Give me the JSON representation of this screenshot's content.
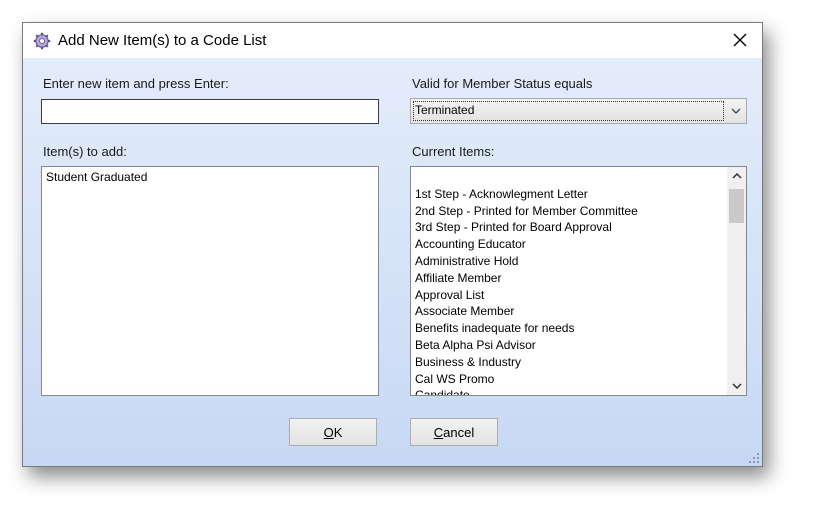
{
  "dialog": {
    "title": "Add New Item(s) to a Code List",
    "close_glyph": "✕"
  },
  "new_item": {
    "label": "Enter new item and press Enter:",
    "value": ""
  },
  "member_status": {
    "label": "Valid for Member Status equals",
    "selected": "Terminated"
  },
  "items_to_add": {
    "label": "Item(s) to add:",
    "items": [
      "Student Graduated"
    ]
  },
  "current_items": {
    "label": "Current Items:",
    "items": [
      "",
      "1st Step - Acknowlegment Letter",
      "2nd Step - Printed for Member Committee",
      "3rd Step - Printed for Board Approval",
      "Accounting Educator",
      "Administrative Hold",
      "Affiliate Member",
      "Approval List",
      "Associate Member",
      "Benefits inadequate for needs",
      "Beta Alpha Psi Advisor",
      "Business & Industry",
      "Cal WS Promo",
      "Candidate"
    ]
  },
  "buttons": {
    "ok_mnemonic": "O",
    "ok_rest": "K",
    "cancel_mnemonic": "C",
    "cancel_rest": "ancel"
  },
  "icons": {
    "title": "gear-icon",
    "close": "close-icon",
    "dropdown": "chevron-down-icon",
    "scroll_up": "chevron-up-icon",
    "scroll_down": "chevron-down-icon",
    "resize": "resize-grip-icon"
  },
  "colors": {
    "client_top": "#e3ecfa",
    "client_bottom": "#c7d8f4"
  }
}
